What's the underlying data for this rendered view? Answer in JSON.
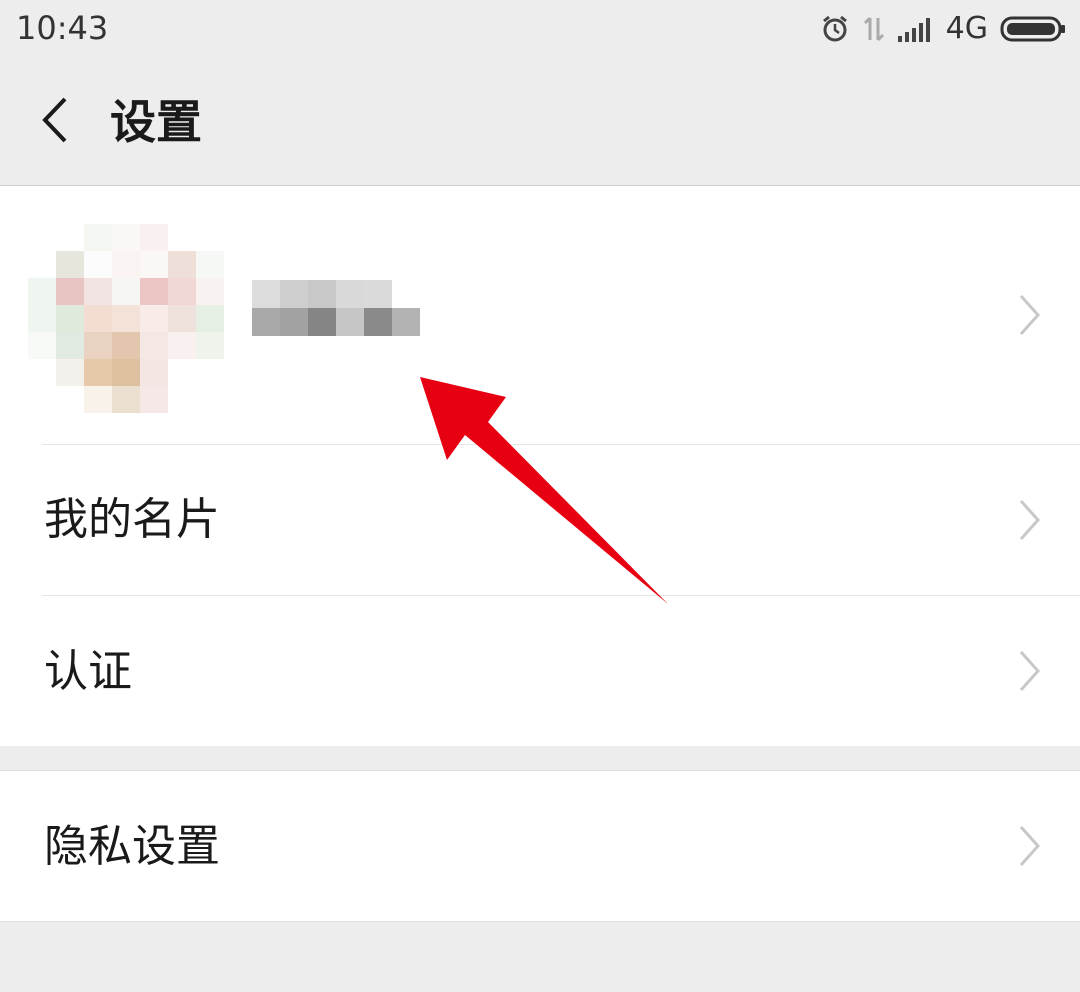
{
  "status_bar": {
    "time": "10:43",
    "network": "4G",
    "icons": [
      "alarm-icon",
      "data-transfer-icon",
      "signal-icon",
      "battery-icon"
    ]
  },
  "header": {
    "back_icon": "chevron-left-icon",
    "title": "设置"
  },
  "profile": {
    "avatar": "pixelated-avatar",
    "name": "pixelated-name"
  },
  "menu": {
    "group1": [
      {
        "label": "我的名片",
        "icon": "chevron-right-icon"
      },
      {
        "label": "认证",
        "icon": "chevron-right-icon"
      }
    ],
    "group2": [
      {
        "label": "隐私设置",
        "icon": "chevron-right-icon"
      }
    ]
  },
  "colors": {
    "background": "#ededed",
    "card": "#ffffff",
    "annotation_arrow": "#e60012",
    "chevron": "#c8c8c8"
  }
}
